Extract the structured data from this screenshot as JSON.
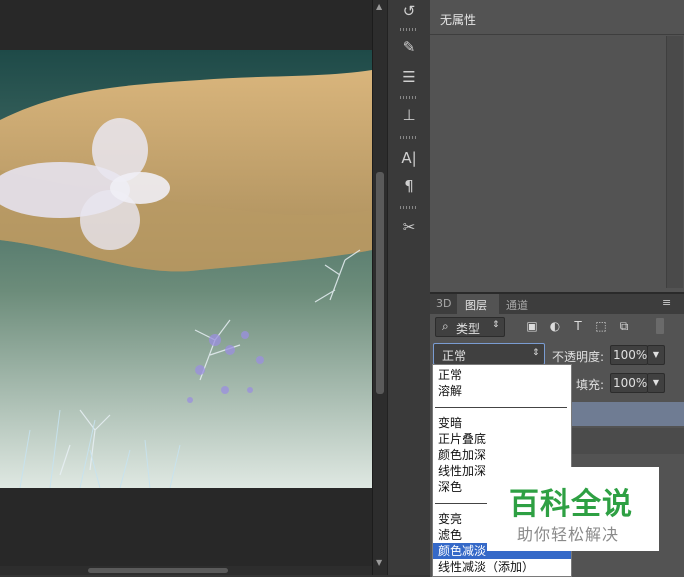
{
  "properties": {
    "title": "无属性"
  },
  "layers_panel": {
    "tabs": [
      {
        "label": "3D"
      },
      {
        "label": "图层"
      },
      {
        "label": "通道"
      }
    ],
    "filter_kind": "类型",
    "blend_mode": "正常",
    "opacity_label": "不透明度:",
    "opacity_value": "100%",
    "fill_label": "填充:",
    "fill_value": "100%"
  },
  "blend_menu": {
    "groups": [
      [
        "正常",
        "溶解"
      ],
      [
        "变暗",
        "正片叠底",
        "颜色加深",
        "线性加深",
        "深色"
      ],
      [
        "变亮",
        "滤色",
        "颜色减淡",
        "线性减淡（添加）"
      ]
    ],
    "selected": "颜色减淡"
  },
  "watermark": {
    "title": "百科全说",
    "subtitle": "助你轻松解决"
  },
  "icons": [
    "history-icon",
    "brush-presets-icon",
    "adjustments-icon",
    "clone-source-icon",
    "character-icon",
    "paragraph-icon",
    "tool-presets-icon"
  ]
}
